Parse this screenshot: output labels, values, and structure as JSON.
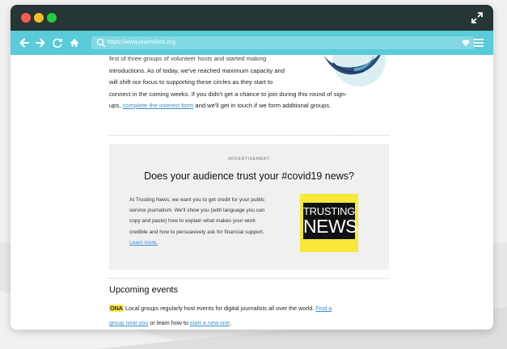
{
  "browser": {
    "url": "https://www.journalists.org"
  },
  "article": {
    "intro_cut": "first of three groups of volunteer hosts and started making",
    "line1": "introductions. As of today, we've reached maximum capacity and",
    "line2": "will shift our focus to supporting these circles as they start to",
    "line3": "connect in the coming weeks. If you didn't get a chance to join during this round of sign-",
    "line4_pre": "ups, ",
    "line4_link": "complete the interest form",
    "line4_post": " and we'll get in touch if we form additional groups."
  },
  "ad": {
    "label": "ADVERTISEMENT",
    "headline": "Does your audience trust your #covid19 news?",
    "body_lines": [
      "At Trusting News, we want you to get credit for your public",
      "service journalism. We'll show you (with language you can",
      "copy and paste) how to explain what makes your work",
      "credible and how to persuasively ask for financial support."
    ],
    "learn_more": "Learn more.",
    "logo_line1": "TRUSTING",
    "logo_line2": "NEWS"
  },
  "events": {
    "heading": "Upcoming events",
    "badge": "ONA",
    "text_pre": " Local groups regularly host events for digital journalists all over the world. ",
    "link1": "Find a",
    "link1_cont": "group near you",
    "text_mid": " or learn how to ",
    "link2": "start a new one",
    "text_end": "."
  },
  "colors": {
    "titlebar": "#263535",
    "toolbar": "#59cbd9",
    "link": "#3a8fcf",
    "ad_background": "#f0f0f0",
    "logo_yellow": "#f7e83a"
  },
  "icons": [
    "back-arrow-icon",
    "forward-arrow-icon",
    "reload-icon",
    "home-icon",
    "search-icon",
    "heart-icon",
    "menu-icon",
    "expand-icon"
  ]
}
